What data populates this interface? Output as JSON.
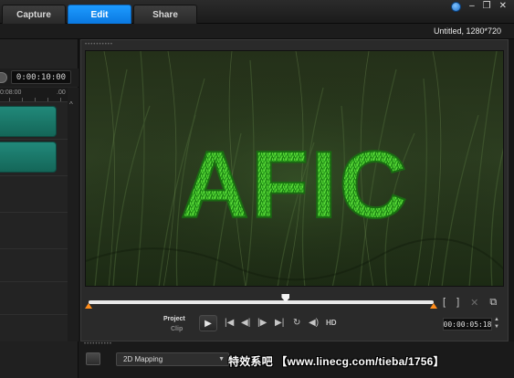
{
  "tabs": [
    {
      "label": "Capture",
      "active": false
    },
    {
      "label": "Edit",
      "active": true
    },
    {
      "label": "Share",
      "active": false
    }
  ],
  "window_controls": {
    "globe_icon": "globe-icon",
    "minimize": "–",
    "restore": "❐",
    "close": "✕"
  },
  "status": {
    "project_info": "Untitled, 1280*720"
  },
  "timeline": {
    "timecode": "0:00:10:00",
    "ruler_labels": [
      "0:08:00",
      ".00"
    ]
  },
  "preview": {
    "title_text": "AFIC",
    "scrub_progress": 0.57
  },
  "playback": {
    "project_label": "Project",
    "clip_label": "Clip",
    "hd_label": "HD",
    "timecode": "00:00:05:18"
  },
  "bottom_panel": {
    "mapping_mode": "2D Mapping",
    "watermark": "特效系吧  【www.linecg.com/tieba/1756】"
  },
  "colors": {
    "active_tab": "#0a84f0",
    "clip": "#1a7a6c",
    "in_out_marker": "#ff8c1a",
    "grass_text": "#3fbf2a"
  }
}
